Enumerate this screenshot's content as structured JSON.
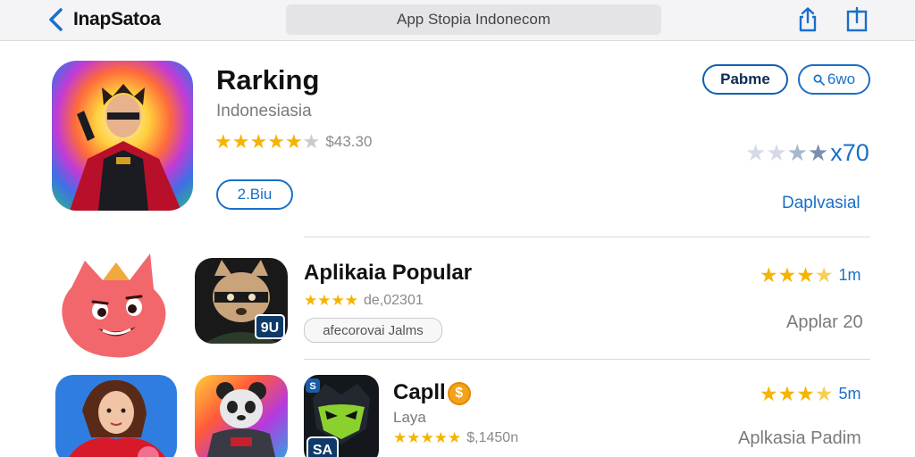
{
  "topbar": {
    "back_label": "InapSatoa",
    "url": "App Stopia Indonecom"
  },
  "featured": {
    "title": "Rarking",
    "subtitle": "Indonesiasia",
    "rating_count": "$43.30",
    "stars_filled": 5,
    "pill_label": "2.Biu",
    "primary_button": "Pabme",
    "search_button": "6wo",
    "rating_value": "x70",
    "link": "Daplvasial"
  },
  "rows": [
    {
      "title": "Aplikaia Popular",
      "rating_count": "de,02301",
      "stars_filled": 4,
      "tag": "afecorovai Jalms",
      "badge_left": "",
      "badge_right": "9U",
      "right_stars_filled": 3,
      "right_size": "1m",
      "right_link": "Applar 20"
    },
    {
      "title": "Capll",
      "subtitle": "Laya",
      "rating_count": "$,1450n",
      "stars_filled": 5,
      "badge_left": "S",
      "badge_right": "SA",
      "right_stars_filled": 3,
      "right_size": "5m",
      "right_link": "Aplkasia Padim"
    }
  ],
  "colors": {
    "accent": "#1a6fc9",
    "star": "#f5b400",
    "topbar_bg": "#f4f4f6"
  },
  "icons": {
    "back": "chevron-left-icon",
    "share": "share-icon",
    "tabs": "tabs-icon",
    "search": "search-icon"
  }
}
